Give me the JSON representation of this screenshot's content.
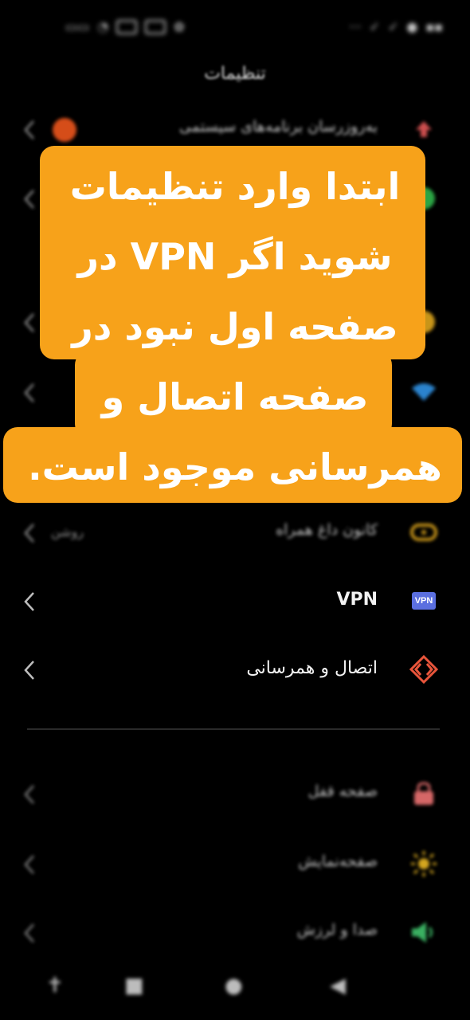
{
  "header": {
    "title": "تنظیمات"
  },
  "settings": {
    "top": [
      {
        "label": "به‌روزرسان برنامه‌های سیستمی",
        "value": ""
      },
      {
        "label": "",
        "value": ""
      },
      {
        "label": "",
        "value": ""
      },
      {
        "label": "",
        "value": ""
      }
    ],
    "mobile_hotspot": {
      "label": "کانون داغ همراه",
      "value": "روشن"
    },
    "vpn": {
      "label": "VPN",
      "badge": "VPN"
    },
    "connection": {
      "label": "اتصال و همرسانی"
    },
    "lock_screen": {
      "label": "صفحه قفل"
    },
    "display": {
      "label": "صفحه‌نمایش"
    },
    "sound": {
      "label": "صدا و لرزش"
    }
  },
  "overlay": {
    "lines": [
      "ابتدا وارد تنظیمات",
      "شوید  اگر VPN در",
      "صفحه اول نبود در",
      "صفحه اتصال و",
      "همرسانی موجود است."
    ]
  },
  "colors": {
    "accent": "#f7a21a",
    "vpn_badge": "#5b6fe0",
    "connection_icon": "#e8553b"
  }
}
